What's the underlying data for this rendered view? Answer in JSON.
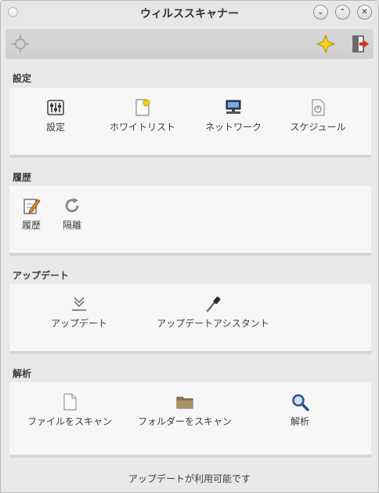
{
  "window": {
    "title": "ウィルススキャナー"
  },
  "titlebar_buttons": {
    "minimize": "⌄",
    "maximize": "⌃",
    "close": "✕"
  },
  "toolbar": {
    "left_icon": "crosshair-icon",
    "favorite_icon": "star-icon",
    "exit_icon": "exit-icon"
  },
  "sections": {
    "settings": {
      "title": "設定",
      "items": [
        {
          "label": "設定",
          "icon": "sliders-icon"
        },
        {
          "label": "ホワイトリスト",
          "icon": "whitelist-icon"
        },
        {
          "label": "ネットワーク",
          "icon": "network-icon"
        },
        {
          "label": "スケジュール",
          "icon": "schedule-icon"
        }
      ]
    },
    "history": {
      "title": "履歴",
      "items": [
        {
          "label": "履歴",
          "icon": "pencil-note-icon"
        },
        {
          "label": "隔離",
          "icon": "quarantine-icon"
        }
      ]
    },
    "update": {
      "title": "アップデート",
      "items": [
        {
          "label": "アップデート",
          "icon": "download-icon"
        },
        {
          "label": "アップデートアシスタント",
          "icon": "eyedropper-icon"
        }
      ]
    },
    "analysis": {
      "title": "解析",
      "items": [
        {
          "label": "ファイルをスキャン",
          "icon": "file-icon"
        },
        {
          "label": "フォルダーをスキャン",
          "icon": "folder-icon"
        },
        {
          "label": "解析",
          "icon": "magnifier-icon"
        }
      ]
    }
  },
  "status": "アップデートが利用可能です",
  "colors": {
    "accent_star": "#f5d21c",
    "exit_arrow": "#d93025",
    "magnifier": "#2a4f8f"
  }
}
